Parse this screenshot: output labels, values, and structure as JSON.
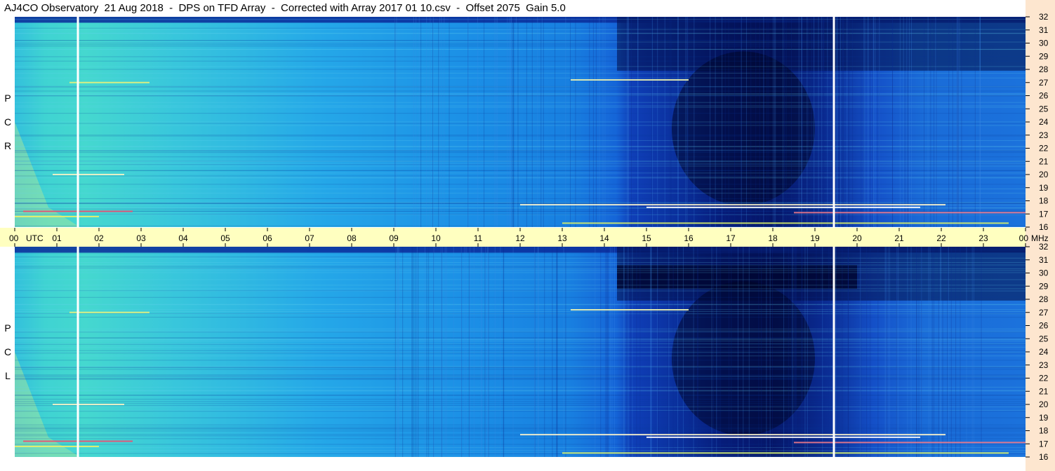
{
  "chart_data": {
    "type": "heatmap",
    "title": "AJ4CO Observatory  21 Aug 2018  -  DPS on TFD Array  -  Corrected with Array 2017 01 10.csv  -  Offset 2075  Gain 5.0",
    "x_tick_labels": [
      "00",
      "01",
      "02",
      "03",
      "04",
      "05",
      "06",
      "07",
      "08",
      "09",
      "10",
      "11",
      "12",
      "13",
      "14",
      "15",
      "16",
      "17",
      "18",
      "19",
      "20",
      "21",
      "22",
      "23",
      "00"
    ],
    "x_unit_label": "UTC",
    "y_tick_labels": [
      "32",
      "31",
      "30",
      "29",
      "28",
      "27",
      "26",
      "25",
      "24",
      "23",
      "22",
      "21",
      "20",
      "19",
      "18",
      "17",
      "16"
    ],
    "y_unit_label": "MHz",
    "xlim": [
      0,
      24
    ],
    "ylim": [
      16,
      32
    ],
    "panels": [
      {
        "label_letters": [
          "R",
          "C",
          "P"
        ]
      },
      {
        "label_letters": [
          "L",
          "C",
          "P"
        ]
      }
    ],
    "markers_utc": [
      1.5,
      19.45
    ],
    "colors": {
      "quiet": "#1f9ae6",
      "bright": "#5fe2d6",
      "deep": "#00126e",
      "hot": "#f4f05a"
    }
  }
}
